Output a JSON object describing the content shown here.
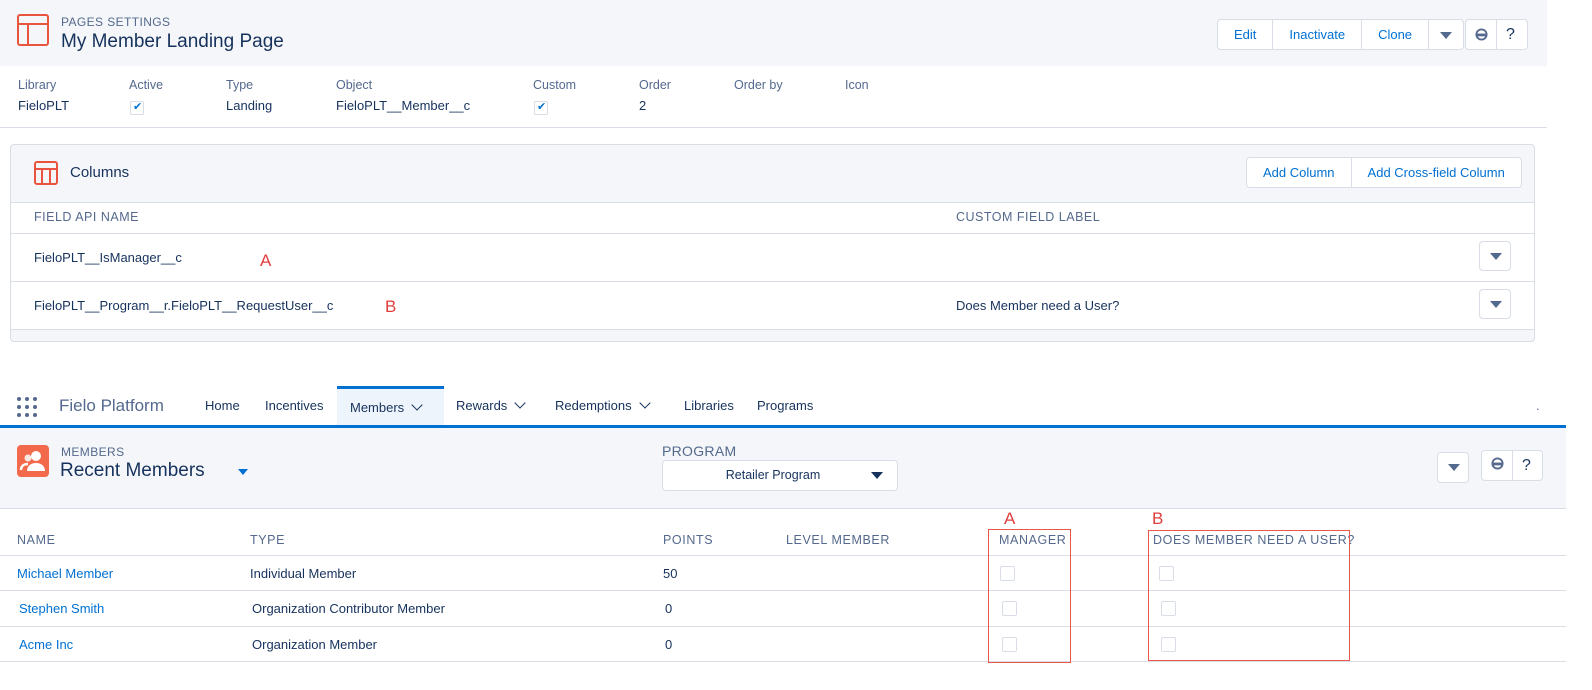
{
  "page_header": {
    "eyebrow": "PAGES SETTINGS",
    "title": "My Member Landing Page",
    "buttons": {
      "edit": "Edit",
      "inactivate": "Inactivate",
      "clone": "Clone"
    }
  },
  "details": {
    "fields": [
      {
        "label": "Library",
        "value": "FieloPLT"
      },
      {
        "label": "Active",
        "value": true
      },
      {
        "label": "Type",
        "value": "Landing"
      },
      {
        "label": "Object",
        "value": "FieloPLT__Member__c"
      },
      {
        "label": "Custom",
        "value": true
      },
      {
        "label": "Order",
        "value": "2"
      },
      {
        "label": "Order by",
        "value": ""
      },
      {
        "label": "Icon",
        "value": ""
      }
    ]
  },
  "columns_card": {
    "title": "Columns",
    "add_column_label": "Add Column",
    "add_cross_field_label": "Add Cross-field Column",
    "headers": {
      "field_api_name": "FIELD API NAME",
      "custom_field_label": "CUSTOM FIELD LABEL"
    },
    "rows": [
      {
        "field": "FieloPLT__IsManager__c",
        "label": "",
        "annotation": "A"
      },
      {
        "field": "FieloPLT__Program__r.FieloPLT__RequestUser__c",
        "label": "Does Member need a User?",
        "annotation": "B"
      }
    ]
  },
  "nav": {
    "app_name": "Fielo Platform",
    "items": [
      {
        "label": "Home",
        "has_menu": false,
        "active": false
      },
      {
        "label": "Incentives",
        "has_menu": false,
        "active": false
      },
      {
        "label": "Members",
        "has_menu": true,
        "active": true
      },
      {
        "label": "Rewards",
        "has_menu": true,
        "active": false
      },
      {
        "label": "Redemptions",
        "has_menu": true,
        "active": false
      },
      {
        "label": "Libraries",
        "has_menu": false,
        "active": false
      },
      {
        "label": "Programs",
        "has_menu": false,
        "active": false
      }
    ],
    "overflow_dot": "."
  },
  "members_header": {
    "eyebrow": "MEMBERS",
    "title": "Recent Members",
    "program_label": "PROGRAM",
    "program_value": "Retailer Program"
  },
  "members_table": {
    "headers": {
      "name": "NAME",
      "type": "TYPE",
      "points": "POINTS",
      "level_member": "LEVEL MEMBER",
      "manager": "MANAGER",
      "needs_user": "DOES MEMBER NEED A USER?"
    },
    "annotations": {
      "manager": "A",
      "needs_user": "B"
    },
    "rows": [
      {
        "name": "Michael Member",
        "type": "Individual Member",
        "points": "50",
        "manager": false,
        "needs_user": false
      },
      {
        "name": "Stephen Smith",
        "type": "Organization Contributor Member",
        "points": "0",
        "manager": false,
        "needs_user": false
      },
      {
        "name": "Acme Inc",
        "type": "Organization Member",
        "points": "0",
        "manager": false,
        "needs_user": false
      }
    ]
  },
  "colors": {
    "accent_blue": "#0070d2",
    "text_dark": "#16325c",
    "text_muted": "#54698d",
    "icon_orange": "#e8543e",
    "annotation_red": "#e03e3e",
    "header_bg": "#f4f6f9",
    "border": "#d8dde6"
  }
}
